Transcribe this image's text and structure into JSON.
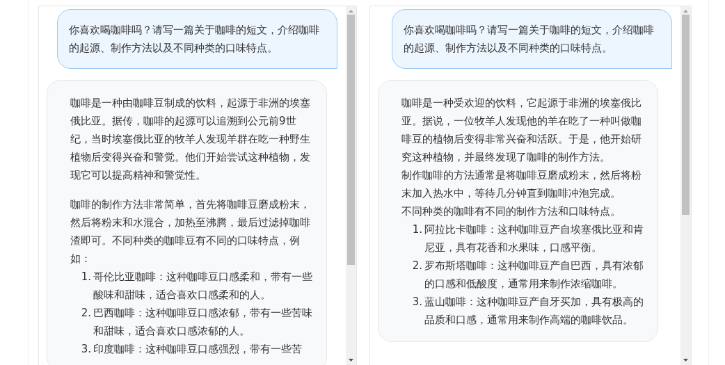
{
  "panels": [
    {
      "user_message": "你喜欢喝咖啡吗？请写一篇关于咖啡的短文，介绍咖啡的起源、制作方法以及不同种类的口味特点。",
      "reply": [
        {
          "kind": "paragraph",
          "text": "咖啡是一种由咖啡豆制成的饮料，起源于非洲的埃塞俄比亚。据传，咖啡的起源可以追溯到公元前9世纪，当时埃塞俄比亚的牧羊人发现羊群在吃一种野生植物后变得兴奋和警觉。他们开始尝试这种植物，发现它可以提高精神和警觉性。"
        },
        {
          "kind": "paragraph",
          "text": "咖啡的制作方法非常简单，首先将咖啡豆磨成粉末，然后将粉末和水混合，加热至沸腾，最后过滤掉咖啡渣即可。不同种类的咖啡豆有不同的口味特点，例如："
        },
        {
          "kind": "list",
          "items": [
            {
              "number": "1.",
              "text": "哥伦比亚咖啡：这种咖啡豆口感柔和，带有一些酸味和甜味，适合喜欢口感柔和的人。"
            },
            {
              "number": "2.",
              "text": "巴西咖啡：这种咖啡豆口感浓郁，带有一些苦味和甜味，适合喜欢口感浓郁的人。"
            },
            {
              "number": "3.",
              "text": "印度咖啡：这种咖啡豆口感强烈，带有一些苦"
            }
          ]
        }
      ]
    },
    {
      "user_message": "你喜欢喝咖啡吗？请写一篇关于咖啡的短文，介绍咖啡的起源、制作方法以及不同种类的口味特点。",
      "reply": [
        {
          "kind": "line",
          "text": "咖啡是一种受欢迎的饮料，它起源于非洲的埃塞俄比亚。据说，一位牧羊人发现他的羊在吃了一种叫做咖啡豆的植物后变得非常兴奋和活跃。于是，他开始研究这种植物，并最终发现了咖啡的制作方法。"
        },
        {
          "kind": "line",
          "text": "制作咖啡的方法通常是将咖啡豆磨成粉末，然后将粉末加入热水中，等待几分钟直到咖啡冲泡完成。"
        },
        {
          "kind": "line",
          "text": "不同种类的咖啡有不同的制作方法和口味特点。"
        },
        {
          "kind": "list",
          "items": [
            {
              "number": "1.",
              "text": "阿拉比卡咖啡：这种咖啡豆产自埃塞俄比亚和肯尼亚，具有花香和水果味，口感平衡。"
            },
            {
              "number": "2.",
              "text": "罗布斯塔咖啡：这种咖啡豆产自巴西，具有浓郁的口感和低酸度，通常用来制作浓缩咖啡。"
            },
            {
              "number": "3.",
              "text": "蓝山咖啡：这种咖啡豆产自牙买加，具有极高的品质和口感，通常用来制作高端的咖啡饮品。"
            }
          ]
        }
      ]
    }
  ]
}
